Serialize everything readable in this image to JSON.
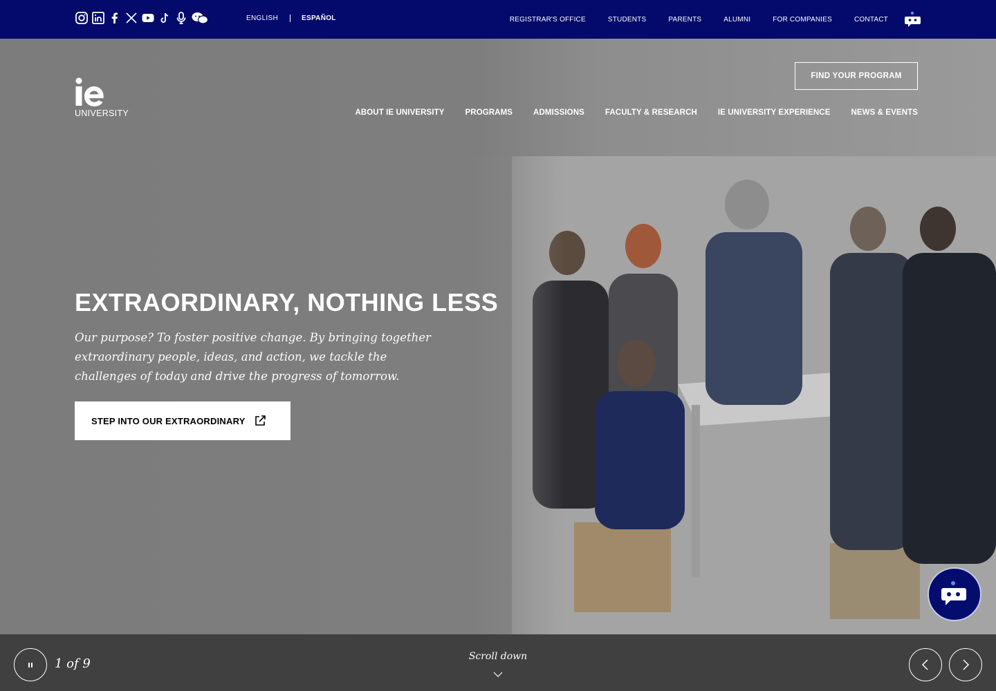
{
  "topbar": {
    "socials": [
      "instagram-icon",
      "linkedin-icon",
      "facebook-icon",
      "x-icon",
      "youtube-icon",
      "tiktok-icon",
      "podcast-icon",
      "wechat-icon"
    ],
    "languages": [
      {
        "label": "ENGLISH",
        "active": false
      },
      {
        "label": "ESPAÑOL",
        "active": true
      }
    ],
    "links": [
      "REGISTRAR'S OFFICE",
      "STUDENTS",
      "PARENTS",
      "ALUMNI",
      "FOR COMPANIES",
      "CONTACT"
    ]
  },
  "header": {
    "logo_word": "UNIVERSITY",
    "find_program": "FIND YOUR PROGRAM",
    "nav": [
      "ABOUT IE UNIVERSITY",
      "PROGRAMS",
      "ADMISSIONS",
      "FACULTY & RESEARCH",
      "IE UNIVERSITY EXPERIENCE",
      "NEWS & EVENTS"
    ]
  },
  "hero": {
    "headline": "EXTRAORDINARY, NOTHING LESS",
    "lead": "Our purpose? To foster positive change. By bringing together extraordinary people, ideas, and action, we tackle the challenges of today and drive the progress of tomorrow.",
    "cta": "STEP INTO OUR EXTRAORDINARY"
  },
  "slider": {
    "counter": "1 of 9",
    "scroll_label": "Scroll down"
  },
  "colors": {
    "brand_navy": "#030a6b",
    "slider_bar": "#404040",
    "chatbot": "#040d6e"
  }
}
